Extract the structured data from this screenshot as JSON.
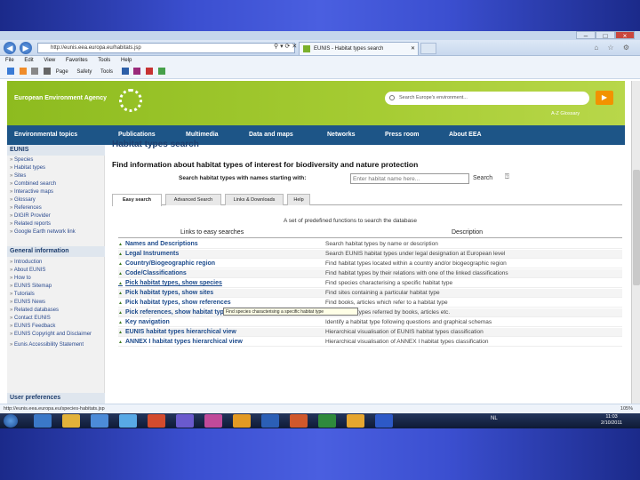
{
  "browser": {
    "address": "http://eunis.eea.europa.eu/habitats.jsp",
    "tab_title": "EUNIS - Habitat types search",
    "menu": [
      "File",
      "Edit",
      "View",
      "Favorites",
      "Tools",
      "Help"
    ],
    "command_bar": [
      "Page",
      "Safety",
      "Tools"
    ],
    "status_url": "http://eunis.eea.europa.eu/species-habitats.jsp",
    "zoom": "105%"
  },
  "banner": {
    "brand": "European Environment Agency",
    "search_placeholder": "Search Europe's environment...",
    "az_glossary": "A-Z Glossary"
  },
  "topnav": [
    "Environmental topics",
    "Publications",
    "Multimedia",
    "Data and maps",
    "Networks",
    "Press room",
    "About EEA"
  ],
  "sidebar": {
    "eunis_title": "EUNIS",
    "eunis_items": [
      "Species",
      "Habitat types",
      "Sites",
      "Combined search",
      "Interactive maps",
      "Glossary",
      "References",
      "DIGIR Provider",
      "Related reports",
      "Google Earth network link"
    ],
    "general_title": "General information",
    "general_items": [
      "Introduction",
      "About EUNIS",
      "How to",
      "EUNIS Sitemap",
      "Tutorials",
      "EUNIS News",
      "Related databases",
      "Contact EUNIS",
      "EUNIS Feedback",
      "EUNIS Copyright and Disclaimer",
      "Eunis Accessibility Statement"
    ],
    "prefs_title": "User preferences"
  },
  "main": {
    "title": "Habitat types search",
    "subtitle": "Find information about habitat types of interest for biodiversity and nature protection",
    "search_label": "Search habitat types with names starting with:",
    "search_placeholder": "Enter habitat name here...",
    "search_button": "Search",
    "tabs": [
      "Easy search",
      "Advanced Search",
      "Links & Downloads",
      "Help"
    ],
    "table_caption": "A set of predefined functions to search the database",
    "col_links": "Links to easy searches",
    "col_desc": "Description",
    "rows": [
      {
        "link": "Names and Descriptions",
        "desc": "Search habitat types by name or description"
      },
      {
        "link": "Legal Instruments",
        "desc": "Search EUNIS habitat types under legal designation at European level"
      },
      {
        "link": "Country/Biogeographic region",
        "desc": "Find habitat types located within a country and/or biogeographic region"
      },
      {
        "link": "Code/Classifications",
        "desc": "Find habitat types by their relations with one of the linked classifications"
      },
      {
        "link": "Pick habitat types, show species",
        "desc": "Find species characterising a specific habitat type"
      },
      {
        "link": "Pick habitat types, show sites",
        "desc": "Find sites containing a particular habitat type"
      },
      {
        "link": "Pick habitat types, show references",
        "desc": "Find books, articles which refer to a habitat type"
      },
      {
        "link": "Pick references, show habitat types",
        "desc": "Find habitat types referred by books, articles etc."
      },
      {
        "link": "Key navigation",
        "desc": "Identify a habitat type following questions and graphical schemas"
      },
      {
        "link": "EUNIS habitat types hierarchical view",
        "desc": "Hierarchical visualisation of EUNIS habitat types classification"
      },
      {
        "link": "ANNEX I habitat types hierarchical view",
        "desc": "Hierarchical visualisation of ANNEX I habitat types classification"
      }
    ],
    "tooltip": "Find species characterising a specific habitat type"
  },
  "taskbar": {
    "lang": "NL",
    "time": "11:03",
    "date": "2/10/2011"
  }
}
